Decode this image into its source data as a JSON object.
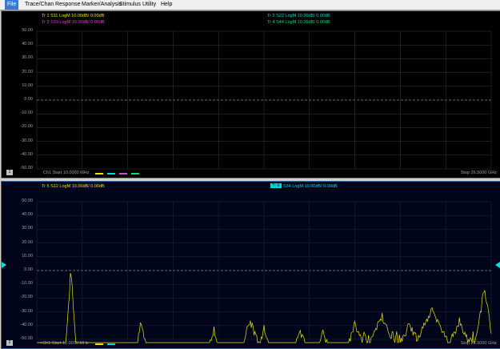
{
  "menu": {
    "items": [
      "File",
      "Trace/Chan",
      "Response",
      "Marker/Analysis",
      "Stimulus",
      "Utility",
      "Help"
    ]
  },
  "ch1": {
    "traces": [
      {
        "text": "Tr 1  S11 LogM 10.00dB/ 0.00dB",
        "color": "#e6e600"
      },
      {
        "text": "Tr 2  S22 LogM 10.00dB/ 0.00dB",
        "color": "#00d8d8"
      },
      {
        "text": "Tr 3  S33 LogM 10.00dB/ 0.00dB",
        "color": "#e040e0"
      },
      {
        "text": "Tr 4  S44 LogM 10.00dB/ 0.00dB",
        "color": "#00e070"
      }
    ],
    "y_ticks": [
      "50.00",
      "40.00",
      "30.00",
      "20.00",
      "10.00",
      "0.00",
      "-10.00",
      "-20.00",
      "-30.00",
      "-40.00",
      "-50.00"
    ],
    "channel_number": "1",
    "footer_start": "Ch1  Start  10.0000 MHz",
    "footer_stop": "Stop  26.5000 GHz"
  },
  "ch2": {
    "traces": [
      {
        "text": "Tr 5  S12 LogM 10.00dB/ 0.00dB",
        "color": "#e6e600"
      },
      {
        "tag": "Tr 6",
        "text": "S34 LogM 10.00dB/ 0.00dB",
        "color": "#00d8d8"
      }
    ],
    "y_ticks": [
      "50.00",
      "40.00",
      "30.00",
      "20.00",
      "10.00",
      "0.00",
      "-10.00",
      "-20.00",
      "-30.00",
      "-40.00",
      "-50.00"
    ],
    "channel_number": "2",
    "footer_start": ">Ch1  Start  10.0000 MHz",
    "footer_stop": "Stop  26.5000 GHz"
  },
  "colors": {
    "yellow": "#e6e600",
    "cyan": "#00d8d8",
    "magenta": "#e040e0",
    "green": "#00e070"
  }
}
